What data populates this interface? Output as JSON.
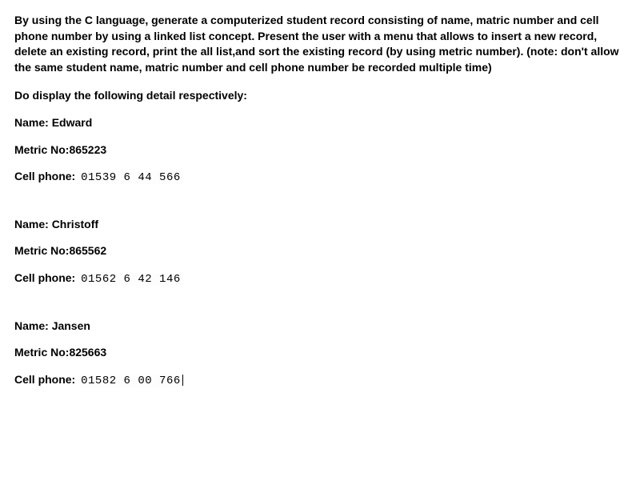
{
  "instructions": "By using the C language, generate a computerized student record consisting of name, matric number and cell phone number by using a linked list concept. Present the user with a menu that allows to insert a new record, delete an existing record, print the all list,and sort the existing record (by using metric number). (note: don't allow the same student name, matric number and cell phone number be recorded multiple time)",
  "subhead": "Do display the following detail respectively:",
  "labels": {
    "name": "Name: ",
    "metric": "Metric No:",
    "cell": "Cell phone: "
  },
  "records": [
    {
      "name": "Edward",
      "metric": "865223",
      "cell": "01539 6 44 566"
    },
    {
      "name": "Christoff",
      "metric": "865562",
      "cell": "01562 6 42 146"
    },
    {
      "name": "Jansen",
      "metric": "825663",
      "cell": "01582 6 00 766"
    }
  ]
}
